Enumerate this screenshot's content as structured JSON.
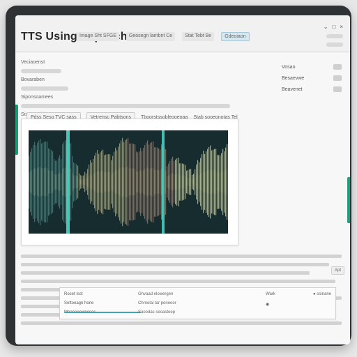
{
  "app": {
    "title": "TTS Using Sepeechn",
    "tabs": [
      "Image Sht SFGE",
      "Geosegn lambnt Ce",
      "Stat Tebt Be",
      "Gdeoiaon"
    ],
    "window_controls": [
      "⌄",
      "□",
      "×"
    ]
  },
  "left_panel": {
    "labels": [
      "Veciaoenst",
      "Bovaraben",
      "Siponsoamees",
      "Sisonscobjeatnetesse"
    ]
  },
  "toolbar": {
    "items": [
      "Pdss Seso TVC sass",
      "Vetrensc Pabtsons",
      "Tboorstssobleooeoaa"
    ],
    "extra_label": "Stab sooeonotas Tel"
  },
  "right_panel": {
    "rows": [
      {
        "label": "Vosao"
      },
      {
        "label": "Besaevwe"
      },
      {
        "label": "Beavenet"
      }
    ]
  },
  "waveform": {
    "description": "Audio spectrogram",
    "palette": [
      "#0b6b6c",
      "#17a08a",
      "#f0a318",
      "#f06128",
      "#f4d33b"
    ]
  },
  "lower_text": {
    "badge": "Apt"
  },
  "form": {
    "left_rows": [
      "Roset Isst",
      "Settoeagn hone",
      "Moaneeewneses"
    ],
    "middle_rows": [
      "Ghvaad elowergen",
      "Chrnelal tar peneeor",
      "Saoodas seoasteep"
    ],
    "right_rows": [
      {
        "label": "Wark",
        "value": "● ssinane"
      },
      {
        "label": "◉",
        "value": ""
      }
    ]
  }
}
